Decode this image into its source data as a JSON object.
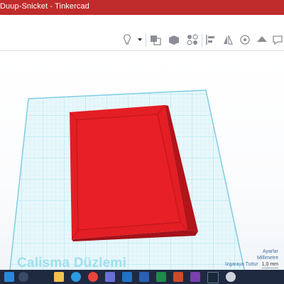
{
  "window": {
    "title": "Duup-Snicket - Tinkercad",
    "title_color": "#c02b2b"
  },
  "toolbar": {
    "icons": [
      "lightbulb-icon",
      "dropdown-caret-icon",
      "group-icon",
      "shape-icon",
      "ungroup-icon",
      "align-icon",
      "mirror-icon",
      "cruise-icon",
      "ruler-icon",
      "notes-icon"
    ]
  },
  "workplane": {
    "label": "Calisma Düzlemi",
    "grid_color": "#8fd8ea",
    "object_color": "#e31e24"
  },
  "settings": {
    "settings_label": "Ayarlar",
    "unit_label": "Millimetre",
    "snap_label": "Izgaraya Tuttur",
    "snap_value": "1,0 mm"
  },
  "taskbar": {
    "icons": [
      "start-icon",
      "search-icon",
      "folder-icon",
      "edge-icon",
      "chrome-icon",
      "store-icon",
      "mail-icon",
      "word-icon",
      "excel-icon",
      "powerpoint-icon",
      "app-icon",
      "steam-icon",
      "gear-icon"
    ]
  }
}
